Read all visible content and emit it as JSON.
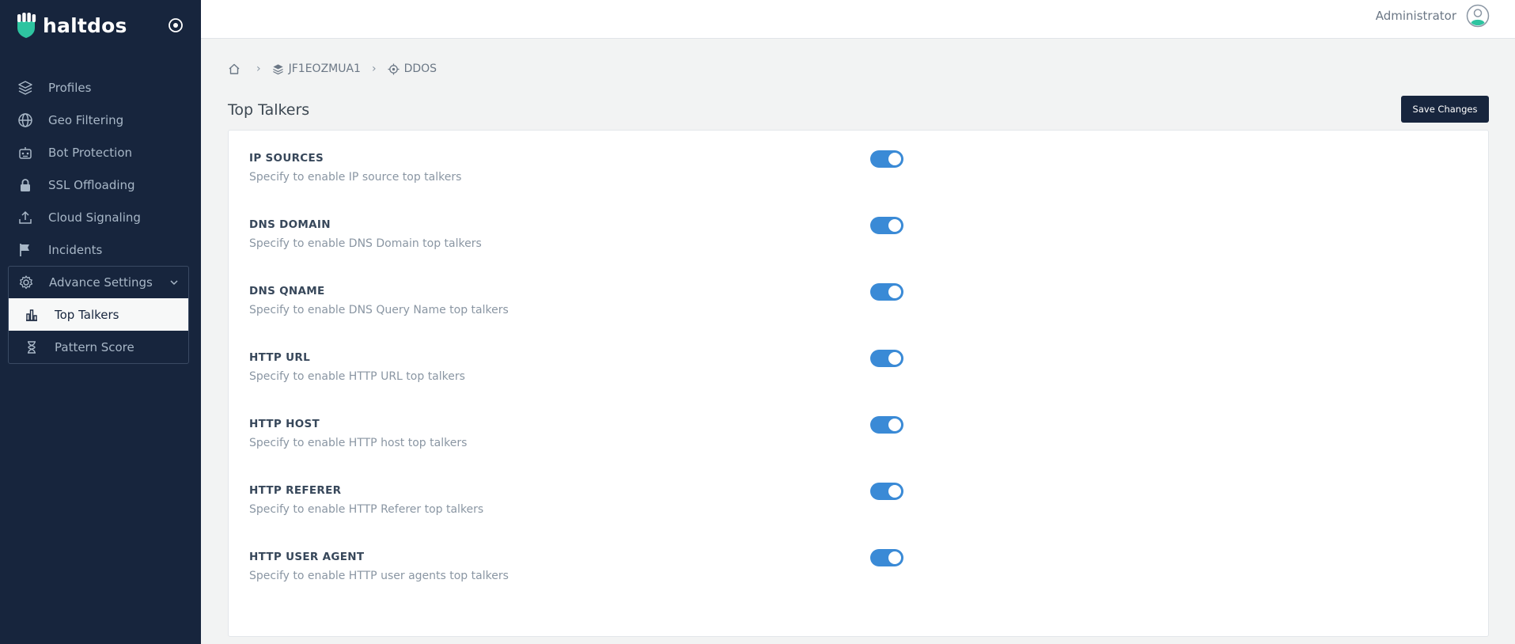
{
  "brand": {
    "name": "haltdos",
    "accent": "#2ec4a0"
  },
  "sidebar": {
    "items": [
      {
        "label": "Profiles",
        "icon": "layers-icon"
      },
      {
        "label": "Geo Filtering",
        "icon": "globe-icon"
      },
      {
        "label": "Bot Protection",
        "icon": "robot-icon"
      },
      {
        "label": "SSL Offloading",
        "icon": "lock-icon"
      },
      {
        "label": "Cloud Signaling",
        "icon": "upload-icon"
      },
      {
        "label": "Incidents",
        "icon": "flag-icon"
      }
    ],
    "group": {
      "label": "Advance Settings",
      "icon": "gear-icon",
      "children": [
        {
          "label": "Top Talkers",
          "icon": "bar-chart-icon",
          "active": true
        },
        {
          "label": "Pattern Score",
          "icon": "hourglass-icon",
          "active": false
        }
      ]
    }
  },
  "header": {
    "user_name": "Administrator"
  },
  "breadcrumb": {
    "profile": "JF1EOZMUA1",
    "module": "DDOS"
  },
  "page": {
    "title": "Top Talkers",
    "save_label": "Save Changes"
  },
  "settings": [
    {
      "title": "IP SOURCES",
      "desc": "Specify to enable IP source top talkers",
      "enabled": true
    },
    {
      "title": "DNS DOMAIN",
      "desc": "Specify to enable DNS Domain top talkers",
      "enabled": true
    },
    {
      "title": "DNS QNAME",
      "desc": "Specify to enable DNS Query Name top talkers",
      "enabled": true
    },
    {
      "title": "HTTP URL",
      "desc": "Specify to enable HTTP URL top talkers",
      "enabled": true
    },
    {
      "title": "HTTP HOST",
      "desc": "Specify to enable HTTP host top talkers",
      "enabled": true
    },
    {
      "title": "HTTP REFERER",
      "desc": "Specify to enable HTTP Referer top talkers",
      "enabled": true
    },
    {
      "title": "HTTP USER AGENT",
      "desc": "Specify to enable HTTP user agents top talkers",
      "enabled": true
    }
  ],
  "colors": {
    "sidebar_bg": "#17253d",
    "toggle_on": "#3a8ad6"
  }
}
